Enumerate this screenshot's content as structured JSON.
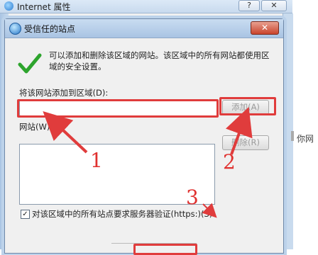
{
  "parent_window": {
    "title": "Internet 属性",
    "help_button": "?",
    "close_button": "✕",
    "side_text": "你网"
  },
  "dialog": {
    "title": "受信任的站点",
    "close_button": "✕",
    "info_text": "可以添加和删除该区域的网站。该区域中的所有网站都使用区域的安全设置。",
    "add_label": "将该网站添加到区域(D):",
    "add_input": {
      "value": "",
      "placeholder": ""
    },
    "add_button": "添加(A)",
    "sites_label": "网站(W):",
    "sites_list": [],
    "remove_button": "删除(R)",
    "require_https_checked": true,
    "require_https_label": "对该区域中的所有站点要求服务器验证(https:)(S)"
  },
  "annotations": {
    "one": "1",
    "two": "2",
    "three": "3",
    "color": "#e03c3c"
  }
}
